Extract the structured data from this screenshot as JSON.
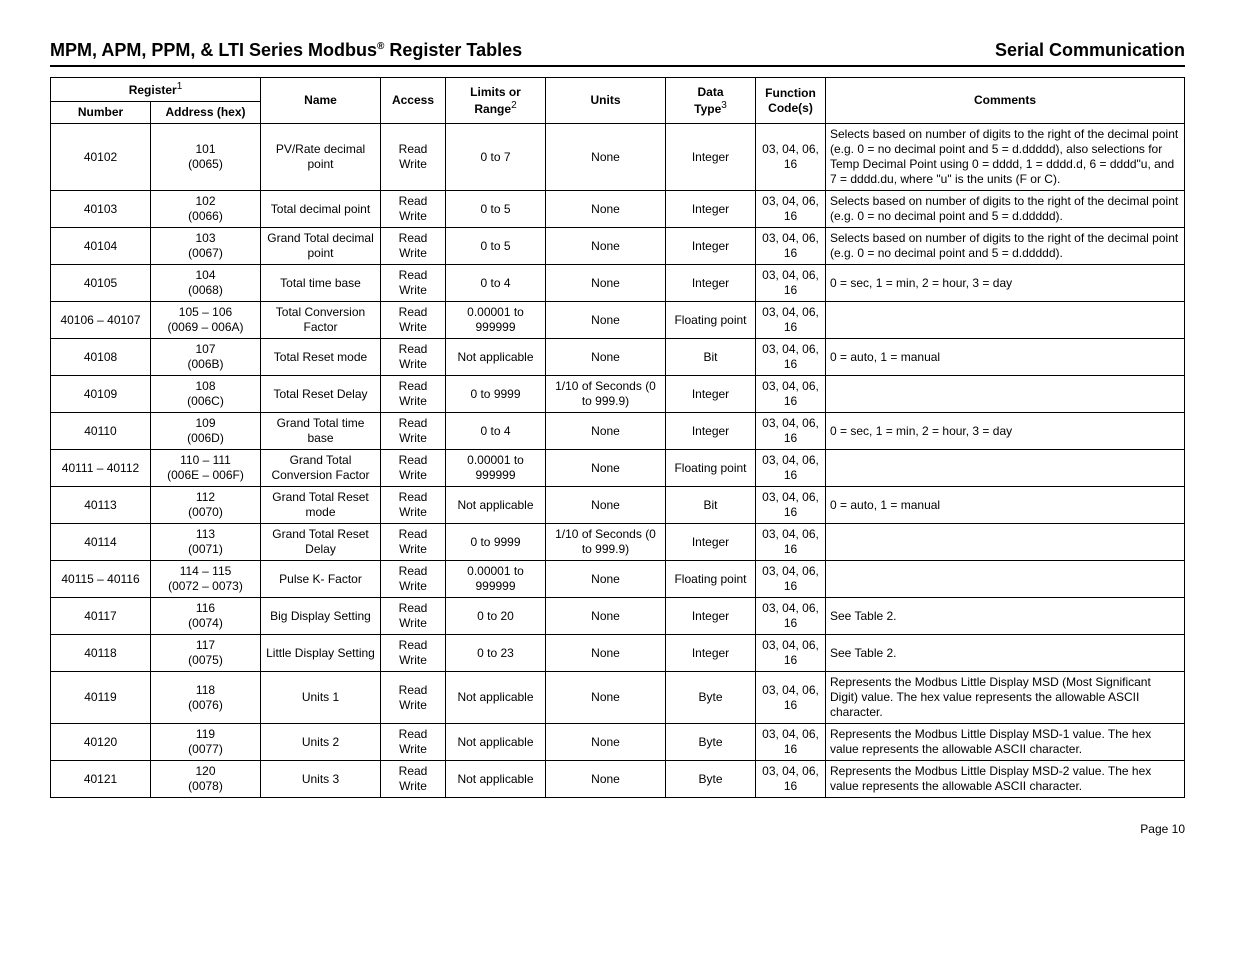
{
  "header": {
    "title_prefix": "MPM, APM, PPM, & LTI Series Modbus",
    "reg_symbol": "®",
    "title_suffix": " Register Tables",
    "right": "Serial Communication"
  },
  "columns": {
    "register_group": "Register",
    "register_sup": "1",
    "number": "Number",
    "address": "Address (hex)",
    "name": "Name",
    "access": "Access",
    "limits_l1": "Limits or",
    "limits_l2": "Range",
    "limits_sup": "2",
    "units": "Units",
    "dtype_l1": "Data",
    "dtype_l2": "Type",
    "dtype_sup": "3",
    "fcode_l1": "Function",
    "fcode_l2": "Code(s)",
    "comments": "Comments"
  },
  "rows": [
    {
      "num": "40102",
      "addr_l1": "101",
      "addr_l2": "(0065)",
      "name": "PV/Rate decimal point",
      "access": "Read Write",
      "limits": "0 to 7",
      "units": "None",
      "dtype": "Integer",
      "fcode": "03, 04, 06, 16",
      "comments": "Selects based on number of digits to the right of the decimal point (e.g. 0 = no decimal point and 5 = d.ddddd), also selections for Temp Decimal Point using 0 = dddd, 1 = dddd.d, 6 = dddd\"u, and 7 = dddd.du, where \"u\" is the units (F or C)."
    },
    {
      "num": "40103",
      "addr_l1": "102",
      "addr_l2": "(0066)",
      "name": "Total decimal point",
      "access": "Read Write",
      "limits": "0 to 5",
      "units": "None",
      "dtype": "Integer",
      "fcode": "03, 04, 06, 16",
      "comments": "Selects based on number of digits to the right of the decimal point (e.g. 0 = no decimal point and 5 = d.ddddd)."
    },
    {
      "num": "40104",
      "addr_l1": "103",
      "addr_l2": "(0067)",
      "name": "Grand Total decimal point",
      "access": "Read Write",
      "limits": "0 to 5",
      "units": "None",
      "dtype": "Integer",
      "fcode": "03, 04, 06, 16",
      "comments": "Selects based on number of digits to the right of the decimal point (e.g. 0 = no decimal point and 5 = d.ddddd)."
    },
    {
      "num": "40105",
      "addr_l1": "104",
      "addr_l2": "(0068)",
      "name": "Total time base",
      "access": "Read Write",
      "limits": "0 to 4",
      "units": "None",
      "dtype": "Integer",
      "fcode": "03, 04, 06, 16",
      "comments": "0 = sec, 1 = min, 2 = hour, 3 = day"
    },
    {
      "num": "40106 – 40107",
      "addr_l1": "105 – 106",
      "addr_l2": "(0069 – 006A)",
      "name": "Total Conversion Factor",
      "access": "Read Write",
      "limits": "0.00001 to 999999",
      "units": "None",
      "dtype": "Floating point",
      "fcode": "03, 04, 06, 16",
      "comments": ""
    },
    {
      "num": "40108",
      "addr_l1": "107",
      "addr_l2": "(006B)",
      "name": "Total Reset mode",
      "access": "Read Write",
      "limits": "Not applicable",
      "units": "None",
      "dtype": "Bit",
      "fcode": "03, 04, 06, 16",
      "comments": "0 = auto, 1 = manual"
    },
    {
      "num": "40109",
      "addr_l1": "108",
      "addr_l2": "(006C)",
      "name": "Total Reset Delay",
      "access": "Read Write",
      "limits": "0 to 9999",
      "units": "1/10 of Seconds (0 to 999.9)",
      "dtype": "Integer",
      "fcode": "03, 04, 06, 16",
      "comments": ""
    },
    {
      "num": "40110",
      "addr_l1": "109",
      "addr_l2": "(006D)",
      "name": "Grand Total time base",
      "access": "Read Write",
      "limits": "0 to 4",
      "units": "None",
      "dtype": "Integer",
      "fcode": "03, 04, 06, 16",
      "comments": "0 = sec, 1 = min, 2 = hour, 3 = day"
    },
    {
      "num": "40111 – 40112",
      "addr_l1": "110 – 111",
      "addr_l2": "(006E – 006F)",
      "name": "Grand Total Conversion Factor",
      "access": "Read Write",
      "limits": "0.00001 to 999999",
      "units": "None",
      "dtype": "Floating point",
      "fcode": "03, 04, 06, 16",
      "comments": ""
    },
    {
      "num": "40113",
      "addr_l1": "112",
      "addr_l2": "(0070)",
      "name": "Grand Total Reset mode",
      "access": "Read Write",
      "limits": "Not applicable",
      "units": "None",
      "dtype": "Bit",
      "fcode": "03, 04, 06, 16",
      "comments": "0 = auto, 1 = manual"
    },
    {
      "num": "40114",
      "addr_l1": "113",
      "addr_l2": "(0071)",
      "name": "Grand Total Reset Delay",
      "access": "Read Write",
      "limits": "0 to 9999",
      "units": "1/10 of Seconds (0 to 999.9)",
      "dtype": "Integer",
      "fcode": "03, 04, 06, 16",
      "comments": ""
    },
    {
      "num": "40115 – 40116",
      "addr_l1": "114 – 115",
      "addr_l2": "(0072 – 0073)",
      "name": "Pulse K- Factor",
      "access": "Read Write",
      "limits": "0.00001 to 999999",
      "units": "None",
      "dtype": "Floating point",
      "fcode": "03, 04, 06, 16",
      "comments": ""
    },
    {
      "num": "40117",
      "addr_l1": "116",
      "addr_l2": "(0074)",
      "name": "Big Display Setting",
      "access": "Read Write",
      "limits": "0 to 20",
      "units": "None",
      "dtype": "Integer",
      "fcode": "03, 04, 06, 16",
      "comments": "See Table 2."
    },
    {
      "num": "40118",
      "addr_l1": "117",
      "addr_l2": "(0075)",
      "name": "Little Display Setting",
      "access": "Read Write",
      "limits": "0 to 23",
      "units": "None",
      "dtype": "Integer",
      "fcode": "03, 04, 06, 16",
      "comments": "See Table 2."
    },
    {
      "num": "40119",
      "addr_l1": "118",
      "addr_l2": "(0076)",
      "name": "Units 1",
      "access": "Read Write",
      "limits": "Not applicable",
      "units": "None",
      "dtype": "Byte",
      "fcode": "03, 04, 06, 16",
      "comments": "Represents the Modbus Little Display MSD (Most Significant Digit) value. The hex value represents the allowable ASCII character."
    },
    {
      "num": "40120",
      "addr_l1": "119",
      "addr_l2": "(0077)",
      "name": "Units 2",
      "access": "Read Write",
      "limits": "Not applicable",
      "units": "None",
      "dtype": "Byte",
      "fcode": "03, 04, 06, 16",
      "comments": "Represents the Modbus Little Display MSD-1 value. The hex value represents the allowable ASCII character."
    },
    {
      "num": "40121",
      "addr_l1": "120",
      "addr_l2": "(0078)",
      "name": "Units 3",
      "access": "Read Write",
      "limits": "Not applicable",
      "units": "None",
      "dtype": "Byte",
      "fcode": "03, 04, 06, 16",
      "comments": "Represents the Modbus Little Display MSD-2 value. The hex value represents the allowable ASCII character."
    }
  ],
  "footer": {
    "page_label": "Page 10"
  }
}
